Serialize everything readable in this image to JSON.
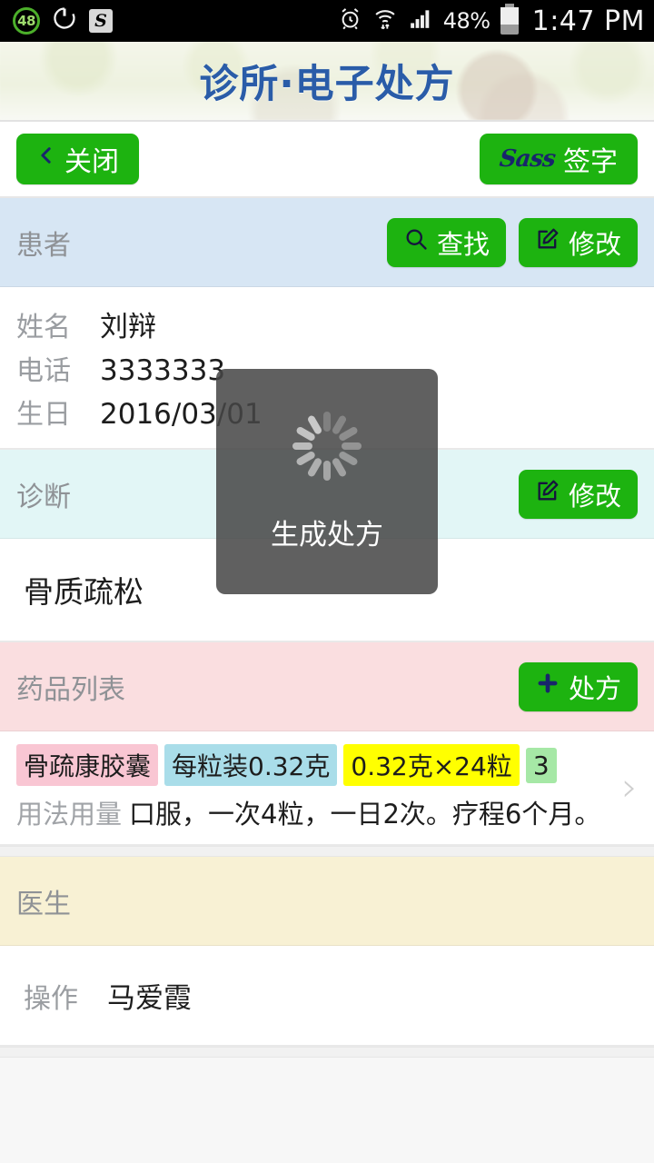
{
  "statusbar": {
    "badge_count": "48",
    "power_icon": "power-sync-icon",
    "s_icon": "S",
    "alarm_icon": "alarm-clock-icon",
    "wifi_icon": "wifi-data-icon",
    "signal_icon": "cellular-signal-icon",
    "battery_percent": "48%",
    "battery_icon": "battery-icon",
    "time": "1:47 PM"
  },
  "header": {
    "title": "诊所·电子处方"
  },
  "toolbar": {
    "close_label": "关闭",
    "close_icon": "chevron-left-icon",
    "sign_label": "签字",
    "sign_logo": "Sass"
  },
  "patient": {
    "section_label": "患者",
    "search_label": "查找",
    "search_icon": "magnifier-icon",
    "edit_label": "修改",
    "edit_icon": "pencil-square-icon",
    "fields": [
      {
        "key": "姓名",
        "value": "刘辩"
      },
      {
        "key": "电话",
        "value": "3333333"
      },
      {
        "key": "生日",
        "value": "2016/03/01"
      }
    ]
  },
  "diagnosis": {
    "section_label": "诊断",
    "edit_label": "修改",
    "edit_icon": "pencil-square-icon",
    "text": "骨质疏松"
  },
  "drugs": {
    "section_label": "药品列表",
    "add_label": "处方",
    "add_icon": "plus-icon",
    "items": [
      {
        "name": "骨疏康胶囊",
        "spec": "每粒装0.32克",
        "package": "0.32克×24粒",
        "quantity": "3",
        "usage_label": "用法用量",
        "usage": "口服，一次4粒，一日2次。疗程6个月。",
        "chevron_icon": "chevron-right-icon"
      }
    ]
  },
  "doctor": {
    "section_label": "医生",
    "operator_key": "操作",
    "operator_value": "马爱霞"
  },
  "overlay": {
    "text": "生成处方",
    "spinner_icon": "loading-spinner-icon"
  },
  "colors": {
    "green_button": "#1db310",
    "header_title": "#2a5ca8",
    "patient_section": "#d7e6f4",
    "diagnosis_section": "#e2f6f6",
    "drugs_section": "#fadee0",
    "doctor_section": "#f8f1d4",
    "tag_name": "#f9c6d3",
    "tag_spec": "#a9dde9",
    "tag_package": "#ffff00",
    "tag_quantity": "#a6e8a6"
  }
}
